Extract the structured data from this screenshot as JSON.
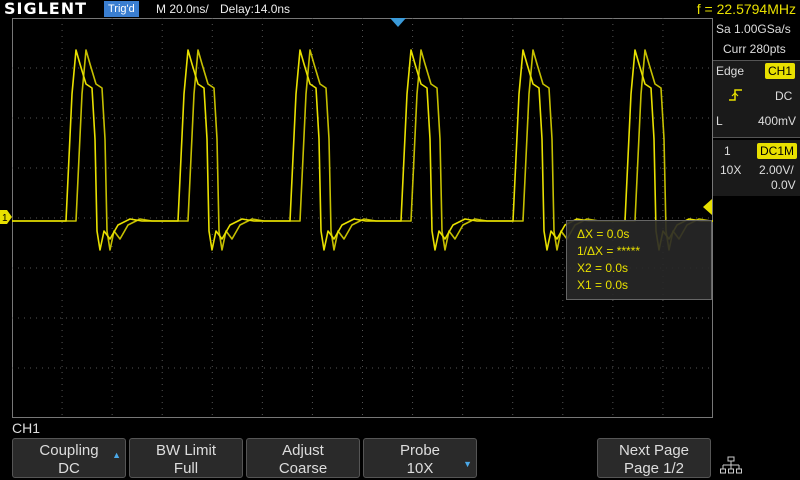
{
  "header": {
    "logo": "SIGLENT",
    "trigger_status": "Trig'd",
    "timebase": "M 20.0ns/",
    "delay": "Delay:14.0ns",
    "frequency": "f = 22.5794MHz"
  },
  "acquisition": {
    "sample_rate": "Sa 1.00GSa/s",
    "memory": "Curr 280pts"
  },
  "trigger": {
    "type": "Edge",
    "source": "CH1",
    "slope_icon": "rising-edge-icon",
    "coupling": "DC",
    "level_label": "L",
    "level": "400mV"
  },
  "channel": {
    "number": "1",
    "coupling": "DC1M",
    "probe": "10X",
    "scale": "2.00V/",
    "offset": "0.0V"
  },
  "measurement": {
    "delta_x": "ΔX = 0.0s",
    "inv_delta_x": "1/ΔX = *****",
    "x2": "X2 = 0.0s",
    "x1": "X1 = 0.0s"
  },
  "menu": {
    "channel_label": "CH1",
    "softkeys": [
      {
        "line1": "Coupling",
        "line2": "DC",
        "has_arrow": true
      },
      {
        "line1": "BW Limit",
        "line2": "Full",
        "has_arrow": false
      },
      {
        "line1": "Adjust",
        "line2": "Coarse",
        "has_arrow": false
      },
      {
        "line1": "Probe",
        "line2": "10X",
        "has_arrow": true
      },
      {
        "line1": "Next Page",
        "line2": "Page 1/2",
        "has_arrow": false
      }
    ],
    "marker_1": "1"
  },
  "colors": {
    "trace": "#e8e000",
    "trigger_status_bg": "#3a7ed0",
    "accent": "#4aa8e8"
  }
}
